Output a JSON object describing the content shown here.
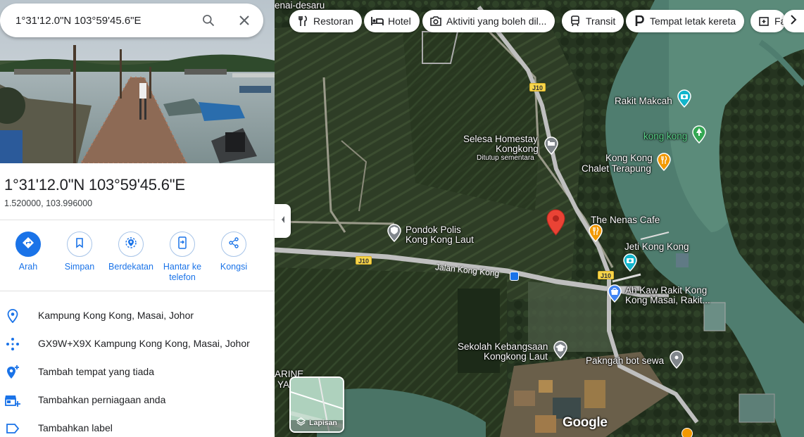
{
  "search": {
    "value": "1°31'12.0\"N 103°59'45.6\"E"
  },
  "place": {
    "title": "1°31'12.0\"N 103°59'45.6\"E",
    "decimal": "1.520000, 103.996000"
  },
  "actions": [
    {
      "label": "Arah",
      "icon": "directions-icon"
    },
    {
      "label": "Simpan",
      "icon": "bookmark-icon"
    },
    {
      "label": "Berdekatan",
      "icon": "nearby-icon"
    },
    {
      "label": "Hantar ke telefon",
      "icon": "send-to-phone-icon"
    },
    {
      "label": "Kongsi",
      "icon": "share-icon"
    }
  ],
  "info": [
    {
      "text": "Kampung Kong Kong, Masai, Johor",
      "icon": "location-pin-icon"
    },
    {
      "text": "GX9W+X9X Kampung Kong Kong, Masai, Johor",
      "icon": "plus-code-icon"
    },
    {
      "text": "Tambah tempat yang tiada",
      "icon": "add-place-icon"
    },
    {
      "text": "Tambahkan perniagaan anda",
      "icon": "add-business-icon"
    },
    {
      "text": "Tambahkan label",
      "icon": "label-icon"
    }
  ],
  "chips": [
    {
      "label": "Restoran",
      "icon": "restaurant-icon"
    },
    {
      "label": "Hotel",
      "icon": "hotel-icon"
    },
    {
      "label": "Aktiviti yang boleh dil...",
      "icon": "camera-icon"
    },
    {
      "label": "Transit",
      "icon": "transit-icon"
    },
    {
      "label": "Tempat letak kereta",
      "icon": "parking-icon"
    },
    {
      "label": "Fa",
      "icon": "pharmacy-icon"
    }
  ],
  "map": {
    "places": {
      "rakit_makcah": "Rakit Makcah",
      "kong_kong": "kong kong",
      "selesa_line1": "Selesa Homestay",
      "selesa_line2": "Kongkong",
      "selesa_status": "Ditutup sementara",
      "chalet_line1": "Kong Kong",
      "chalet_line2": "Chalet Terapung",
      "nenas": "The Nenas Cafe",
      "jeti": "Jeti Kong Kong",
      "polis_line1": "Pondok Polis",
      "polis_line2": "Kong Kong Laut",
      "ahkaw_line1": "Ah Kaw Rakit Kong",
      "ahkaw_line2": "Kong Masai, Rakit...",
      "sekolah_line1": "Sekolah Kebangsaan",
      "sekolah_line2": "Kongkong Laut",
      "paknglah": "Pakngah bot sewa",
      "top_left": "enai-desaru",
      "marine1": "ARINE",
      "marine2": "YA"
    },
    "roads": {
      "jalan": "Jalan Kong Kong",
      "shield": "J10"
    },
    "layers_label": "Lapisan",
    "brand": "Google"
  }
}
